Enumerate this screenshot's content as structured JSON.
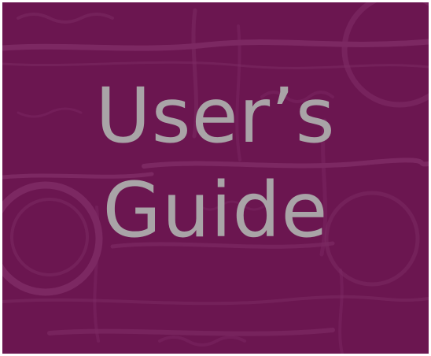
{
  "cover": {
    "title_line_1": "User’s",
    "title_line_2": "Guide"
  },
  "colors": {
    "background": "#6b1650",
    "title_text": "#a9a4a7",
    "texture": "#8a3a72"
  }
}
